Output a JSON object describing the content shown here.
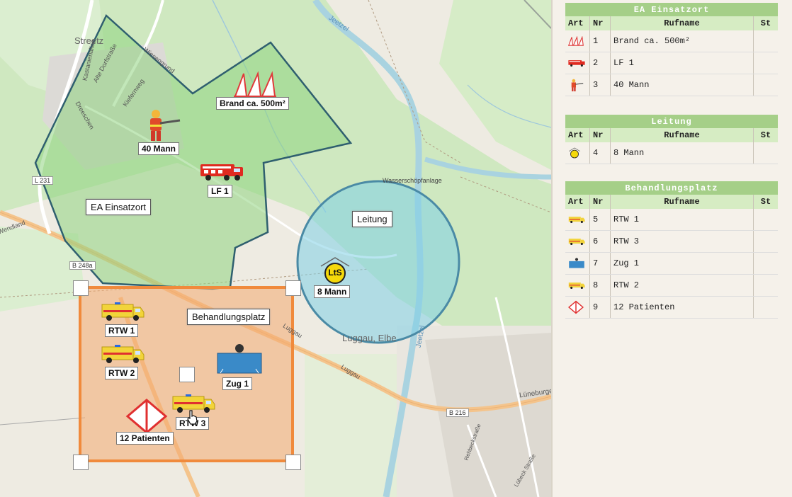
{
  "map": {
    "place_labels": {
      "streetz": "Streetz",
      "luggau": "Luggau, Elbe",
      "wasserschoepf": "Wasserschöpfanlage",
      "jeetzel_top": "Jeetzel",
      "jeetzel_bottom": "Jeetzel"
    },
    "street_labels": {
      "kastanienallee": "Kastanienallee",
      "alte_dorfstrasse": "Alte Dorfstraße",
      "wiesengrund": "Wiesengrund",
      "kiefernweg": "Kiefernweg",
      "dreeschen": "Dreeschen",
      "luggau_road": "Luggau",
      "lueneburger": "Lüneburger",
      "wendland": "Wendland",
      "rehbeckstrasse": "Rehbeckstraße",
      "luebeck_strasse": "Lübeck Straße"
    },
    "road_tags": {
      "l231": "L 231",
      "b248a": "B 248a",
      "b216": "B 216"
    },
    "zones": {
      "einsatzort": "EA Einsatzort",
      "leitung": "Leitung",
      "behandlungsplatz": "Behandlungsplatz"
    },
    "unit_labels": {
      "brand": "Brand ca. 500m²",
      "mann40": "40 Mann",
      "lf1": "LF 1",
      "mann8": "8 Mann",
      "rtw1": "RTW 1",
      "rtw2": "RTW 2",
      "rtw3": "RTW 3",
      "zug1": "Zug 1",
      "patienten": "12 Patienten",
      "lts": "LtS"
    }
  },
  "panel": {
    "columns": {
      "art": "Art",
      "nr": "Nr",
      "rufname": "Rufname",
      "st": "St"
    },
    "sections": [
      {
        "title": "EA Einsatzort",
        "rows": [
          {
            "icon": "fire-icon",
            "nr": "1",
            "rufname": "Brand ca. 500m²"
          },
          {
            "icon": "fire-truck-icon",
            "nr": "2",
            "rufname": "LF 1"
          },
          {
            "icon": "firefighter-icon",
            "nr": "3",
            "rufname": "40 Mann"
          }
        ]
      },
      {
        "title": "Leitung",
        "rows": [
          {
            "icon": "command-icon",
            "nr": "4",
            "rufname": "8 Mann"
          }
        ]
      },
      {
        "title": "Behandlungsplatz",
        "rows": [
          {
            "icon": "ambulance-icon",
            "nr": "5",
            "rufname": "RTW 1"
          },
          {
            "icon": "ambulance-icon",
            "nr": "6",
            "rufname": "RTW 3"
          },
          {
            "icon": "unit-icon",
            "nr": "7",
            "rufname": "Zug 1"
          },
          {
            "icon": "ambulance-icon",
            "nr": "8",
            "rufname": "RTW 2"
          },
          {
            "icon": "patient-icon",
            "nr": "9",
            "rufname": "12 Patienten"
          }
        ]
      }
    ]
  },
  "colors": {
    "zone_green": "#8fd47f",
    "zone_border": "#2f5f6f",
    "leitung_fill": "#7fd0e6",
    "behandlung_fill": "#f4a970",
    "behandlung_border": "#f08a3c",
    "panel_header": "#a5cf88",
    "panel_cols": "#d6ecc3"
  }
}
